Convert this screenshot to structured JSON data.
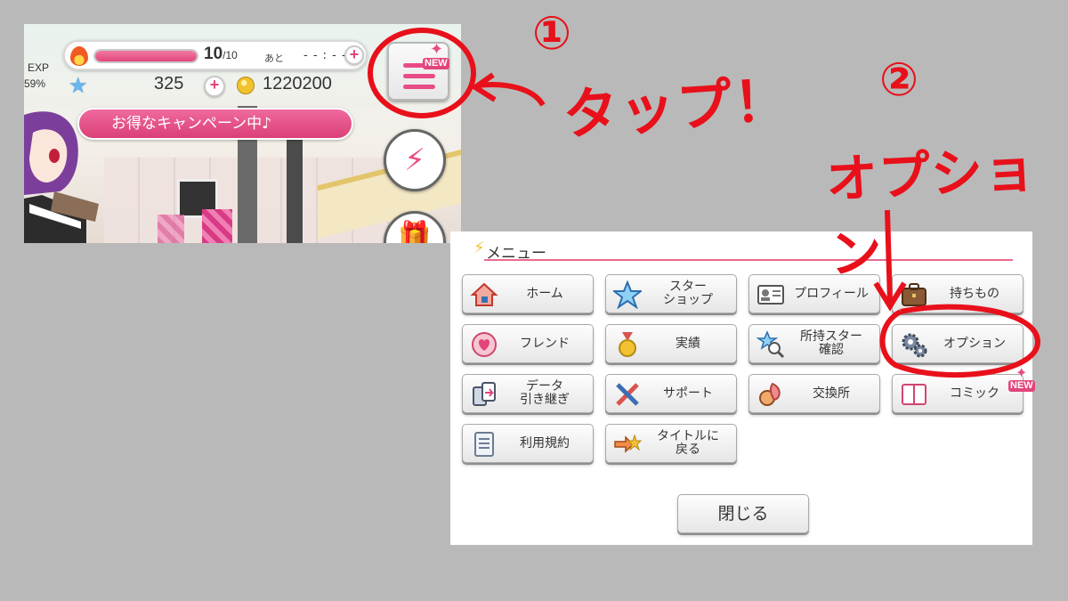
{
  "game": {
    "stamina_value": "10",
    "stamina_max": "/10",
    "stamina_fraction": 1.0,
    "after_label": "あと",
    "timer": "- - : - -",
    "exp_label": "EXP",
    "exp_percent": "59%",
    "gem_count": "325",
    "coin_count": "1220200",
    "campaign_banner": "お得なキャンペーン中♪",
    "menu_new_badge": "NEW"
  },
  "annotations": {
    "step1_number": "①",
    "step1_text": "タップ！",
    "step2_number": "②",
    "step2_text": "オプション",
    "color": "#e8101a"
  },
  "dialog": {
    "title": "メニュー",
    "tiles": [
      {
        "label": "ホーム",
        "icon": "house-icon"
      },
      {
        "label": "スター\nショップ",
        "icon": "star-shop-icon"
      },
      {
        "label": "プロフィール",
        "icon": "profile-card-icon"
      },
      {
        "label": "持ちもの",
        "icon": "bag-icon"
      },
      {
        "label": "フレンド",
        "icon": "friend-heart-icon"
      },
      {
        "label": "実績",
        "icon": "medal-icon"
      },
      {
        "label": "所持スター\n確認",
        "icon": "star-search-icon"
      },
      {
        "label": "オプション",
        "icon": "gear-icon"
      },
      {
        "label": "データ\n引き継ぎ",
        "icon": "data-transfer-icon"
      },
      {
        "label": "サポート",
        "icon": "tools-icon"
      },
      {
        "label": "交換所",
        "icon": "exchange-icon"
      },
      {
        "label": "コミック",
        "icon": "comic-icon"
      },
      {
        "label": "利用規約",
        "icon": "document-icon"
      },
      {
        "label": "タイトルに\n戻る",
        "icon": "return-arrow-icon"
      }
    ],
    "comic_new_badge": "NEW",
    "close_label": "閉じる"
  },
  "colors": {
    "accent_pink": "#e2457c",
    "annotation_red": "#e8101a",
    "background": "#b9b9b9"
  }
}
